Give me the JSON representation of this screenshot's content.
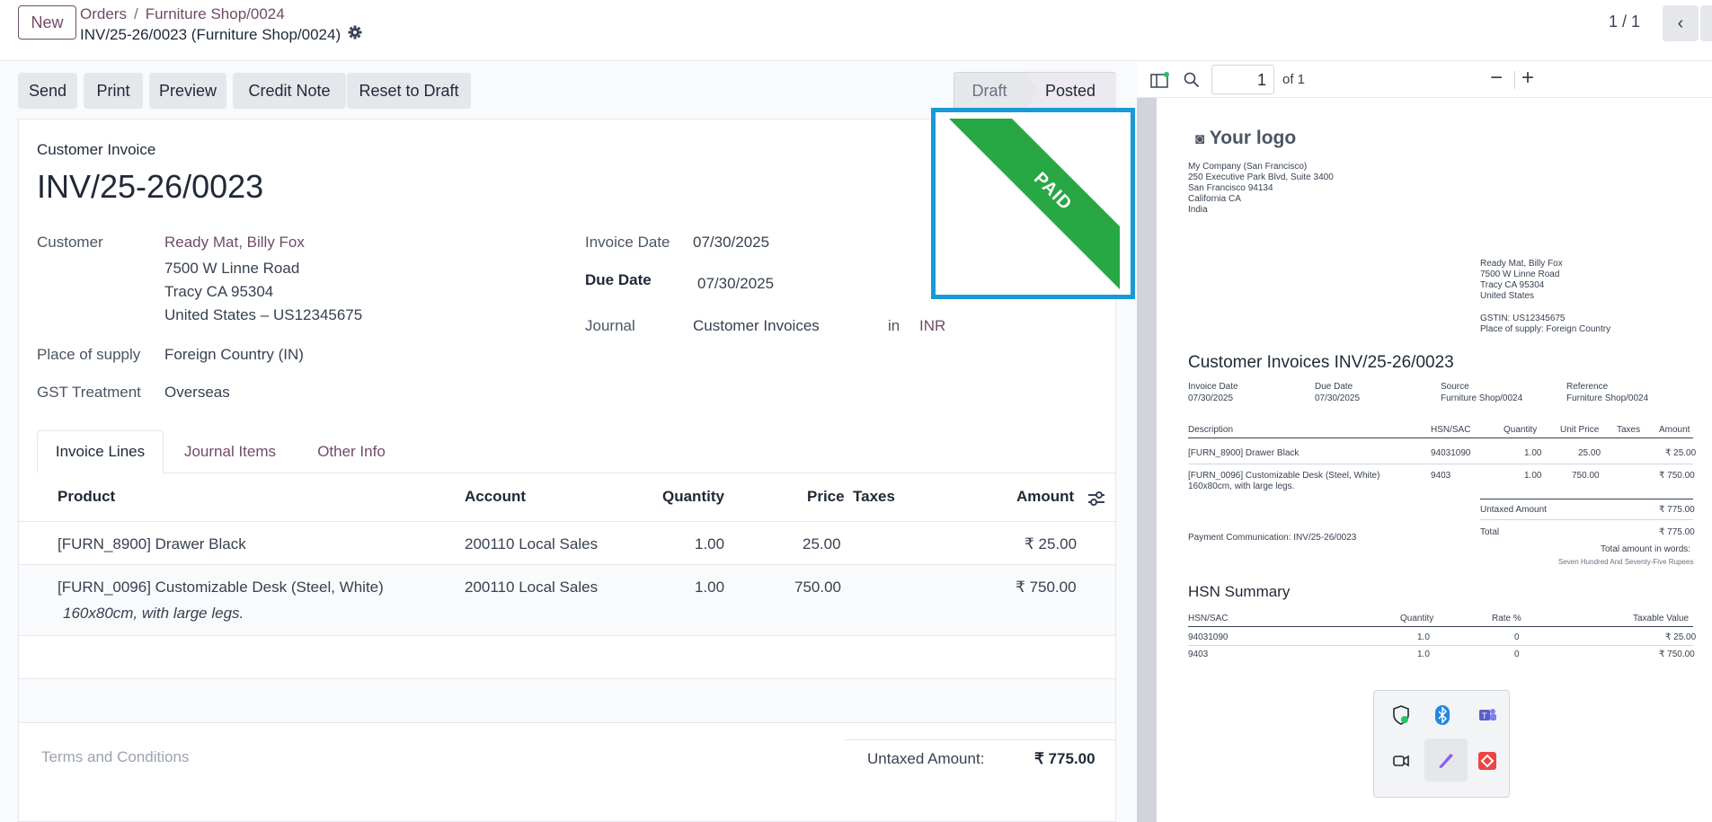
{
  "header": {
    "new_label": "New",
    "breadcrumb": [
      "Orders",
      "Furniture Shop/0024"
    ],
    "record_title": "INV/25-26/0023 (Furniture Shop/0024)",
    "pager": "1 / 1"
  },
  "actions": [
    "Send",
    "Print",
    "Preview",
    "Credit Note",
    "Reset to Draft"
  ],
  "status": {
    "draft": "Draft",
    "posted": "Posted"
  },
  "ribbon": "PAID",
  "form": {
    "type_label": "Customer Invoice",
    "number": "INV/25-26/0023",
    "customer_label": "Customer",
    "customer_name": "Ready Mat, Billy Fox",
    "address": [
      "7500 W Linne Road",
      "Tracy CA 95304",
      "United States – US12345675"
    ],
    "place_label": "Place of supply",
    "place_value": "Foreign Country (IN)",
    "gst_label": "GST Treatment",
    "gst_value": "Overseas",
    "invoice_date_label": "Invoice Date",
    "invoice_date": "07/30/2025",
    "due_date_label": "Due Date",
    "due_date": "07/30/2025",
    "journal_label": "Journal",
    "journal_value": "Customer Invoices",
    "in_label": "in",
    "currency": "INR"
  },
  "tabs": [
    "Invoice Lines",
    "Journal Items",
    "Other Info"
  ],
  "table": {
    "headers": [
      "Product",
      "Account",
      "Quantity",
      "Price",
      "Taxes",
      "Amount"
    ],
    "rows": [
      {
        "product": "[FURN_8900] Drawer Black",
        "desc": "",
        "account": "200110 Local Sales",
        "qty": "1.00",
        "price": "25.00",
        "amount": "₹ 25.00"
      },
      {
        "product": "[FURN_0096] Customizable Desk (Steel, White)",
        "desc": "160x80cm, with large legs.",
        "account": "200110 Local Sales",
        "qty": "1.00",
        "price": "750.00",
        "amount": "₹ 750.00"
      }
    ]
  },
  "footer": {
    "terms": "Terms and Conditions",
    "untaxed_label": "Untaxed Amount:",
    "untaxed_value": "₹ 775.00"
  },
  "pdf": {
    "page_input": "1",
    "of_label": "of 1",
    "logo": "Your logo",
    "company": "My Company (San Francisco)\n250 Executive Park Blvd, Suite 3400\nSan Francisco 94134\nCalifornia CA\nIndia",
    "client": "Ready Mat, Billy Fox\n7500 W Linne Road\nTracy CA 95304\nUnited States",
    "gstin": "GSTIN: US12345675\nPlace of supply: Foreign Country",
    "title": "Customer Invoices INV/25-26/0023",
    "meta_labels": [
      "Invoice Date",
      "Due Date",
      "Source",
      "Reference"
    ],
    "meta_values": [
      "07/30/2025",
      "07/30/2025",
      "Furniture Shop/0024",
      "Furniture Shop/0024"
    ],
    "line_headers": [
      "Description",
      "HSN/SAC",
      "Quantity",
      "Unit Price",
      "Taxes",
      "Amount"
    ],
    "lines": [
      {
        "desc": "[FURN_8900] Drawer Black",
        "hsn": "94031090",
        "qty": "1.00",
        "price": "25.00",
        "amount": "₹ 25.00"
      },
      {
        "desc": "[FURN_0096] Customizable Desk (Steel, White)\n160x80cm, with large legs.",
        "hsn": "9403",
        "qty": "1.00",
        "price": "750.00",
        "amount": "₹ 750.00"
      }
    ],
    "untaxed_label": "Untaxed Amount",
    "untaxed_value": "₹ 775.00",
    "payment_comm": "Payment Communication: INV/25-26/0023",
    "total_label": "Total",
    "total_value": "₹ 775.00",
    "words_label": "Total amount in words:",
    "words_value": "Seven Hundred And Seventy-Five Rupees",
    "hsn_title": "HSN Summary",
    "hsn_headers": [
      "HSN/SAC",
      "Quantity",
      "Rate %",
      "Taxable Value"
    ],
    "hsn_rows": [
      {
        "code": "94031090",
        "qty": "1.0",
        "rate": "0",
        "value": "₹ 25.00"
      },
      {
        "code": "9403",
        "qty": "1.0",
        "rate": "0",
        "value": "₹ 750.00"
      }
    ]
  },
  "colors": {
    "brand": "#714b67",
    "paid_green": "#28a745",
    "highlight": "#179ad6"
  }
}
